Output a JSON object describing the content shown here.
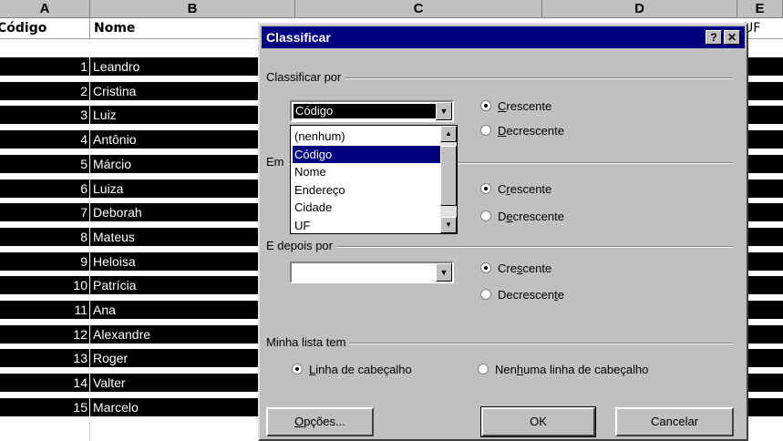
{
  "sheet": {
    "columns": [
      "A",
      "B",
      "C",
      "D",
      "E"
    ],
    "headers": {
      "a": "Código",
      "b": "Nome",
      "e": "UF"
    },
    "rows": [
      {
        "code": "1",
        "name": "Leandro"
      },
      {
        "code": "2",
        "name": "Cristina"
      },
      {
        "code": "3",
        "name": "Luiz"
      },
      {
        "code": "4",
        "name": "Antônio"
      },
      {
        "code": "5",
        "name": "Márcio"
      },
      {
        "code": "6",
        "name": "Luiza"
      },
      {
        "code": "7",
        "name": "Deborah"
      },
      {
        "code": "8",
        "name": "Mateus"
      },
      {
        "code": "9",
        "name": "Heloisa"
      },
      {
        "code": "10",
        "name": "Patrícia"
      },
      {
        "code": "11",
        "name": "Ana"
      },
      {
        "code": "12",
        "name": "Alexandre"
      },
      {
        "code": "13",
        "name": "Roger"
      },
      {
        "code": "14",
        "name": "Valter"
      },
      {
        "code": "15",
        "name": "Marcelo"
      }
    ]
  },
  "dialog": {
    "title": "Classificar",
    "help_glyph": "?",
    "close_glyph": "✕",
    "group1": {
      "label": "Classificar por",
      "combo_value": "Código",
      "radio_asc": {
        "pre": "",
        "key": "C",
        "post": "rescente"
      },
      "radio_desc": {
        "pre": "",
        "key": "D",
        "post": "ecrescente"
      }
    },
    "group2": {
      "label": "Em",
      "radio_asc": {
        "pre": "C",
        "key": "r",
        "post": "escente"
      },
      "radio_desc": {
        "pre": "D",
        "key": "e",
        "post": "crescente"
      }
    },
    "group3": {
      "label": "E depois por",
      "combo_value": "",
      "radio_asc": {
        "pre": "Cre",
        "key": "s",
        "post": "cente"
      },
      "radio_desc": {
        "pre": "Decrescen",
        "key": "t",
        "post": "e"
      }
    },
    "dropdown_options": [
      "(nenhum)",
      "Código",
      "Nome",
      "Endereço",
      "Cidade",
      "UF"
    ],
    "dropdown_selected": "Código",
    "list_group": {
      "label": "Minha lista tem",
      "opt_header": {
        "pre": "",
        "key": "L",
        "post": "inha de cabeçalho"
      },
      "opt_noheader": {
        "pre": "Nen",
        "key": "h",
        "post": "uma linha de cabeçalho"
      }
    },
    "buttons": {
      "options": "Opções...",
      "ok": "OK",
      "cancel": "Cancelar"
    },
    "options_button": {
      "key": "O",
      "rest": "pções..."
    },
    "arrow_down": "▼",
    "arrow_up": "▲"
  }
}
